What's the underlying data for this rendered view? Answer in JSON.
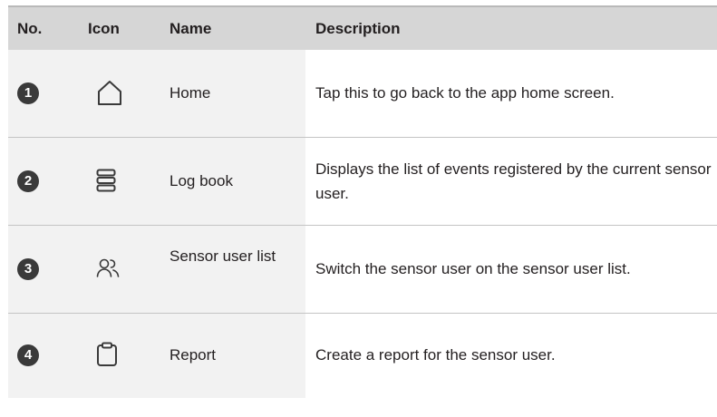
{
  "header": {
    "no": "No.",
    "icon": "Icon",
    "name": "Name",
    "description": "Description"
  },
  "rows": [
    {
      "number": "1",
      "icon": "home-icon",
      "name": "Home",
      "description": "Tap this to go back to the app home screen."
    },
    {
      "number": "2",
      "icon": "log-book-icon",
      "name": "Log book",
      "description": "Displays the list of events registered by the current sensor user."
    },
    {
      "number": "3",
      "icon": "users-icon",
      "name": "Sensor user list",
      "description": "Switch the sensor user on the sensor user list."
    },
    {
      "number": "4",
      "icon": "clipboard-icon",
      "name": "Report",
      "description": "Create a report for the sensor user."
    }
  ]
}
